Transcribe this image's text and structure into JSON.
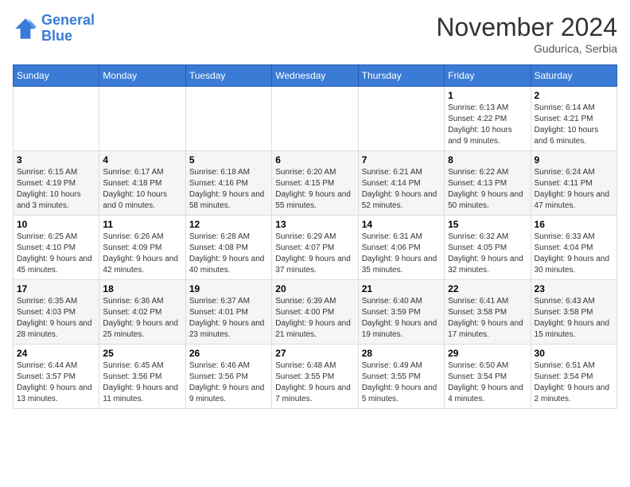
{
  "logo": {
    "line1": "General",
    "line2": "Blue"
  },
  "header": {
    "month": "November 2024",
    "location": "Gudurica, Serbia"
  },
  "days_of_week": [
    "Sunday",
    "Monday",
    "Tuesday",
    "Wednesday",
    "Thursday",
    "Friday",
    "Saturday"
  ],
  "weeks": [
    [
      {
        "day": "",
        "info": ""
      },
      {
        "day": "",
        "info": ""
      },
      {
        "day": "",
        "info": ""
      },
      {
        "day": "",
        "info": ""
      },
      {
        "day": "",
        "info": ""
      },
      {
        "day": "1",
        "info": "Sunrise: 6:13 AM\nSunset: 4:22 PM\nDaylight: 10 hours and 9 minutes."
      },
      {
        "day": "2",
        "info": "Sunrise: 6:14 AM\nSunset: 4:21 PM\nDaylight: 10 hours and 6 minutes."
      }
    ],
    [
      {
        "day": "3",
        "info": "Sunrise: 6:15 AM\nSunset: 4:19 PM\nDaylight: 10 hours and 3 minutes."
      },
      {
        "day": "4",
        "info": "Sunrise: 6:17 AM\nSunset: 4:18 PM\nDaylight: 10 hours and 0 minutes."
      },
      {
        "day": "5",
        "info": "Sunrise: 6:18 AM\nSunset: 4:16 PM\nDaylight: 9 hours and 58 minutes."
      },
      {
        "day": "6",
        "info": "Sunrise: 6:20 AM\nSunset: 4:15 PM\nDaylight: 9 hours and 55 minutes."
      },
      {
        "day": "7",
        "info": "Sunrise: 6:21 AM\nSunset: 4:14 PM\nDaylight: 9 hours and 52 minutes."
      },
      {
        "day": "8",
        "info": "Sunrise: 6:22 AM\nSunset: 4:13 PM\nDaylight: 9 hours and 50 minutes."
      },
      {
        "day": "9",
        "info": "Sunrise: 6:24 AM\nSunset: 4:11 PM\nDaylight: 9 hours and 47 minutes."
      }
    ],
    [
      {
        "day": "10",
        "info": "Sunrise: 6:25 AM\nSunset: 4:10 PM\nDaylight: 9 hours and 45 minutes."
      },
      {
        "day": "11",
        "info": "Sunrise: 6:26 AM\nSunset: 4:09 PM\nDaylight: 9 hours and 42 minutes."
      },
      {
        "day": "12",
        "info": "Sunrise: 6:28 AM\nSunset: 4:08 PM\nDaylight: 9 hours and 40 minutes."
      },
      {
        "day": "13",
        "info": "Sunrise: 6:29 AM\nSunset: 4:07 PM\nDaylight: 9 hours and 37 minutes."
      },
      {
        "day": "14",
        "info": "Sunrise: 6:31 AM\nSunset: 4:06 PM\nDaylight: 9 hours and 35 minutes."
      },
      {
        "day": "15",
        "info": "Sunrise: 6:32 AM\nSunset: 4:05 PM\nDaylight: 9 hours and 32 minutes."
      },
      {
        "day": "16",
        "info": "Sunrise: 6:33 AM\nSunset: 4:04 PM\nDaylight: 9 hours and 30 minutes."
      }
    ],
    [
      {
        "day": "17",
        "info": "Sunrise: 6:35 AM\nSunset: 4:03 PM\nDaylight: 9 hours and 28 minutes."
      },
      {
        "day": "18",
        "info": "Sunrise: 6:36 AM\nSunset: 4:02 PM\nDaylight: 9 hours and 25 minutes."
      },
      {
        "day": "19",
        "info": "Sunrise: 6:37 AM\nSunset: 4:01 PM\nDaylight: 9 hours and 23 minutes."
      },
      {
        "day": "20",
        "info": "Sunrise: 6:39 AM\nSunset: 4:00 PM\nDaylight: 9 hours and 21 minutes."
      },
      {
        "day": "21",
        "info": "Sunrise: 6:40 AM\nSunset: 3:59 PM\nDaylight: 9 hours and 19 minutes."
      },
      {
        "day": "22",
        "info": "Sunrise: 6:41 AM\nSunset: 3:58 PM\nDaylight: 9 hours and 17 minutes."
      },
      {
        "day": "23",
        "info": "Sunrise: 6:43 AM\nSunset: 3:58 PM\nDaylight: 9 hours and 15 minutes."
      }
    ],
    [
      {
        "day": "24",
        "info": "Sunrise: 6:44 AM\nSunset: 3:57 PM\nDaylight: 9 hours and 13 minutes."
      },
      {
        "day": "25",
        "info": "Sunrise: 6:45 AM\nSunset: 3:56 PM\nDaylight: 9 hours and 11 minutes."
      },
      {
        "day": "26",
        "info": "Sunrise: 6:46 AM\nSunset: 3:56 PM\nDaylight: 9 hours and 9 minutes."
      },
      {
        "day": "27",
        "info": "Sunrise: 6:48 AM\nSunset: 3:55 PM\nDaylight: 9 hours and 7 minutes."
      },
      {
        "day": "28",
        "info": "Sunrise: 6:49 AM\nSunset: 3:55 PM\nDaylight: 9 hours and 5 minutes."
      },
      {
        "day": "29",
        "info": "Sunrise: 6:50 AM\nSunset: 3:54 PM\nDaylight: 9 hours and 4 minutes."
      },
      {
        "day": "30",
        "info": "Sunrise: 6:51 AM\nSunset: 3:54 PM\nDaylight: 9 hours and 2 minutes."
      }
    ]
  ]
}
